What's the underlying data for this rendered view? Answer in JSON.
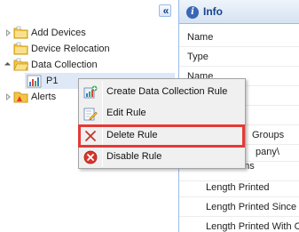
{
  "tree": {
    "collapse_glyph": "«",
    "nodes": [
      {
        "label": "Add Devices",
        "icon": "folder-icon"
      },
      {
        "label": "Device Relocation",
        "icon": "folder-icon"
      },
      {
        "label": "Data Collection",
        "icon": "folder-open-icon"
      },
      {
        "label": "P1",
        "icon": "bar-chart-icon"
      },
      {
        "label": "Alerts",
        "icon": "folder-warning-icon"
      }
    ]
  },
  "info": {
    "title": "Info",
    "rows": [
      "Name",
      "Type",
      "Name",
      "",
      "",
      "Groups",
      "pany\\",
      "Collected Items",
      "Length Printed",
      "Length Printed Since",
      "Length Printed With C"
    ]
  },
  "context_menu": {
    "items": [
      {
        "label": "Create Data Collection Rule",
        "icon": "add-rule-icon"
      },
      {
        "label": "Edit Rule",
        "icon": "edit-icon"
      },
      {
        "label": "Delete Rule",
        "icon": "delete-icon"
      },
      {
        "label": "Disable Rule",
        "icon": "disable-icon"
      }
    ]
  },
  "colors": {
    "highlight_border": "#e53935",
    "selection": "#dfe8f6",
    "panel_border": "#99bbe8"
  }
}
